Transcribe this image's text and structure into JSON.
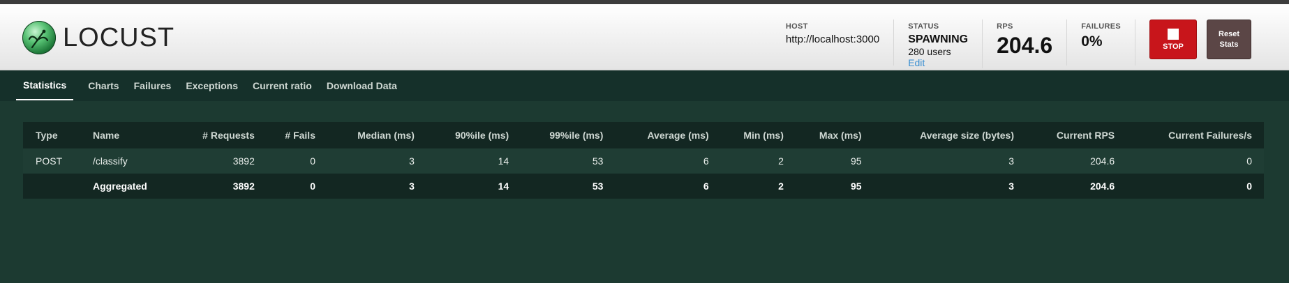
{
  "app": {
    "logo_text": "LOCUST"
  },
  "stats": {
    "host_label": "HOST",
    "host_value": "http://localhost:3000",
    "status_label": "STATUS",
    "status_value": "SPAWNING",
    "status_users": "280 users",
    "status_edit": "Edit",
    "rps_label": "RPS",
    "rps_value": "204.6",
    "failures_label": "FAILURES",
    "failures_value": "0%"
  },
  "buttons": {
    "stop_label": "STOP",
    "reset_line1": "Reset",
    "reset_line2": "Stats"
  },
  "tabs": [
    "Statistics",
    "Charts",
    "Failures",
    "Exceptions",
    "Current ratio",
    "Download Data"
  ],
  "table": {
    "headers": [
      "Type",
      "Name",
      "# Requests",
      "# Fails",
      "Median (ms)",
      "90%ile (ms)",
      "99%ile (ms)",
      "Average (ms)",
      "Min (ms)",
      "Max (ms)",
      "Average size (bytes)",
      "Current RPS",
      "Current Failures/s"
    ],
    "rows": [
      [
        "POST",
        "/classify",
        "3892",
        "0",
        "3",
        "14",
        "53",
        "6",
        "2",
        "95",
        "3",
        "204.6",
        "0"
      ]
    ],
    "aggregated": [
      "",
      "Aggregated",
      "3892",
      "0",
      "3",
      "14",
      "53",
      "6",
      "2",
      "95",
      "3",
      "204.6",
      "0"
    ]
  },
  "colors": {
    "background": "#1c3a31",
    "tabs_bar": "#15302a",
    "stop_button": "#c8151b",
    "reset_button": "#5b4646",
    "edit_link": "#3b8fd1"
  }
}
